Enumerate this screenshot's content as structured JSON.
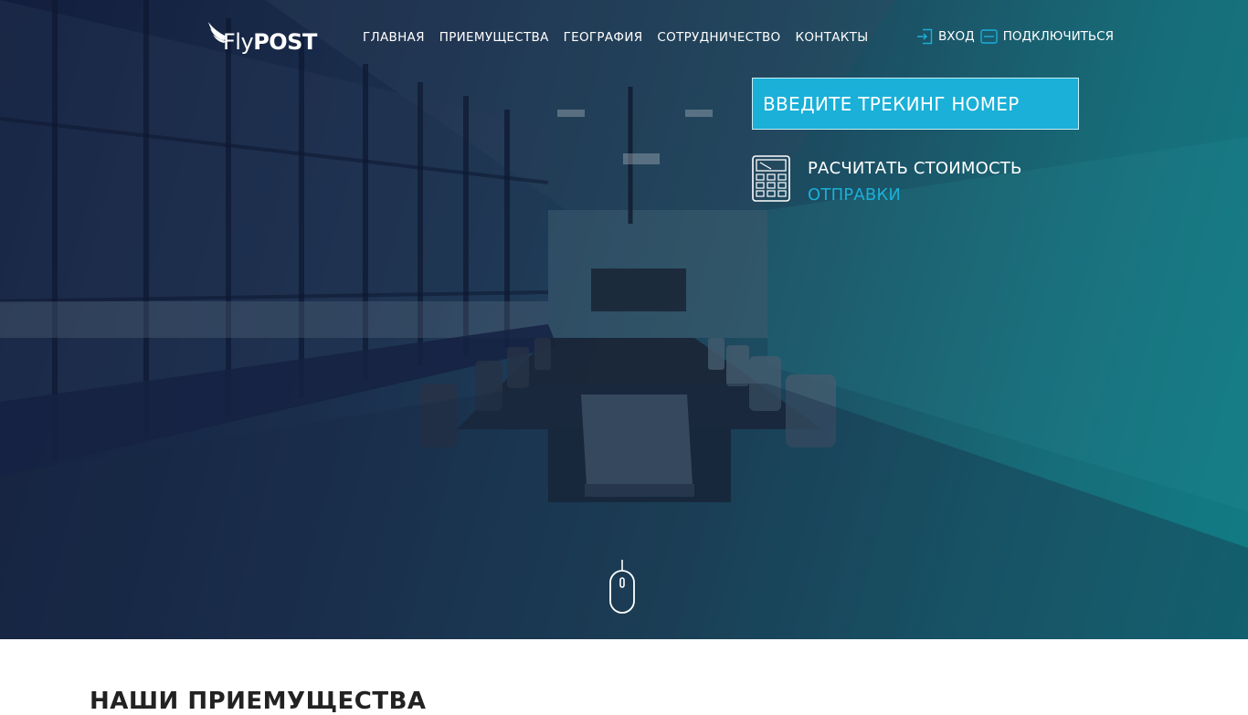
{
  "brand": {
    "logo_part1": "Fly",
    "logo_part2": "POST"
  },
  "nav": {
    "items": [
      {
        "label": "ГЛАВНАЯ"
      },
      {
        "label": "ПРИЕМУЩЕСТВА"
      },
      {
        "label": "ГЕОГРАФИЯ"
      },
      {
        "label": "СОТРУДНИЧЕСТВО"
      },
      {
        "label": "КОНТАКТЫ"
      }
    ]
  },
  "auth": {
    "login_label": "ВХОД",
    "login_icon": "login-icon",
    "connect_label": "ПОДКЛЮЧИТЬСЯ",
    "connect_icon": "minus-box-icon"
  },
  "tracking": {
    "placeholder": "ВВЕДИТЕ ТРЕКИНГ НОМЕР"
  },
  "calculate": {
    "line1": "РАСЧИТАТЬ СТОИМОСТЬ",
    "line2": "ОТПРАВКИ",
    "icon": "calculator-icon"
  },
  "scroll": {
    "icon": "mouse-scroll-icon"
  },
  "advantages": {
    "title": "НАШИ ПРИЕМУЩЕСТВА"
  },
  "colors": {
    "accent": "#1ab0d8",
    "hero_dark": "#141d3c",
    "hero_teal": "#118a8f",
    "text_white": "#ffffff",
    "heading_dark": "#222222"
  }
}
